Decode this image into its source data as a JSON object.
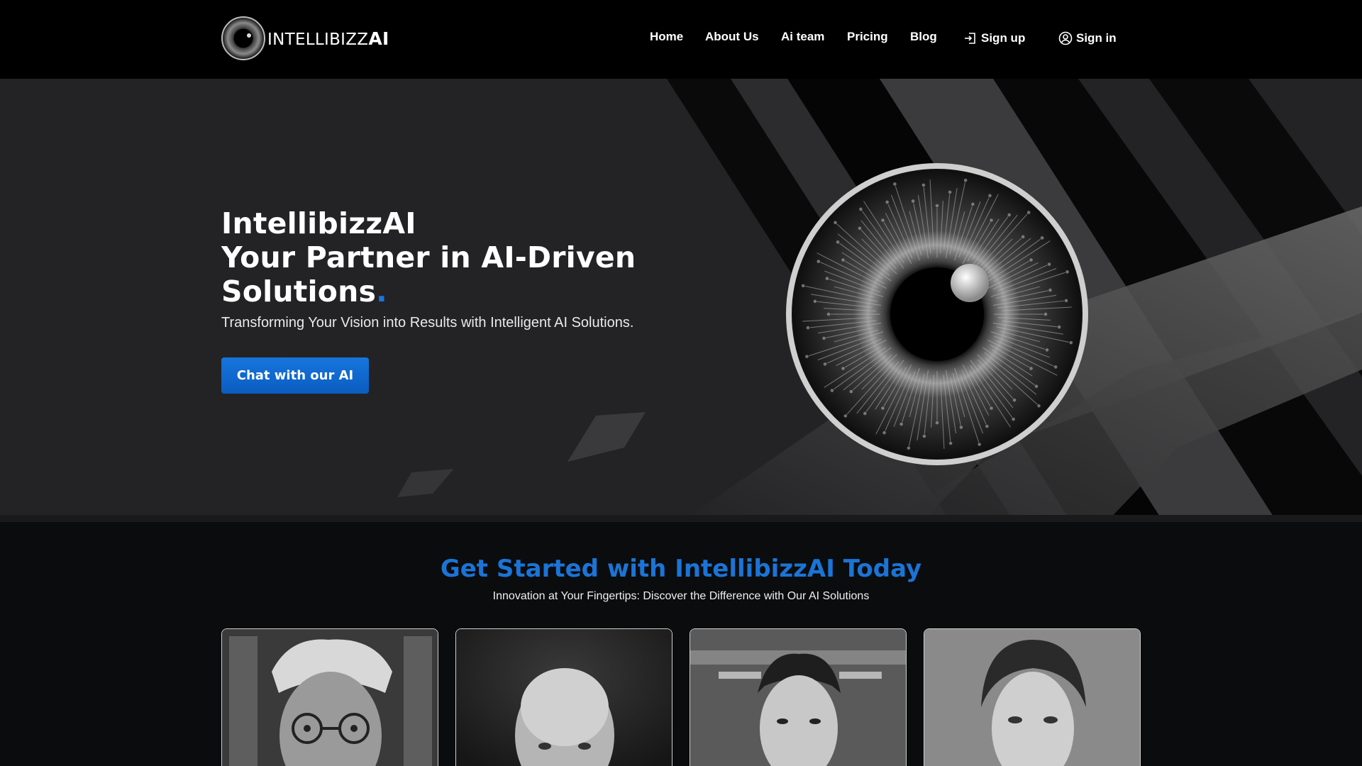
{
  "brand": {
    "name_light": "INTELLIBIZZ",
    "name_bold": "AI"
  },
  "nav": {
    "items": [
      {
        "label": "Home"
      },
      {
        "label": "About Us"
      },
      {
        "label": "Ai team"
      },
      {
        "label": "Pricing"
      },
      {
        "label": "Blog"
      }
    ],
    "signup": {
      "label": "Sign up",
      "icon": "sign-up-icon"
    },
    "signin": {
      "label": "Sign in",
      "icon": "user-circle-icon"
    }
  },
  "hero": {
    "title_line1": "IntellibizzAI",
    "title_line2": "Your Partner in AI-Driven",
    "title_line3": "Solutions",
    "title_dot": ".",
    "subtitle": "Transforming Your Vision into Results with Intelligent AI Solutions.",
    "cta_label": "Chat with our AI"
  },
  "get_started": {
    "title": "Get Started with IntellibizzAI Today",
    "tagline": "Innovation at Your Fingertips: Discover the Difference with Our AI Solutions",
    "cards": [
      {
        "icon": "ai-agent-portrait-1"
      },
      {
        "icon": "ai-agent-portrait-2"
      },
      {
        "icon": "ai-agent-portrait-3"
      },
      {
        "icon": "ai-agent-portrait-4"
      }
    ]
  },
  "colors": {
    "accent": "#1b74e4",
    "nav_bg": "#000000",
    "hero_bg": "#232325",
    "page_bg": "#0b0c0e"
  }
}
